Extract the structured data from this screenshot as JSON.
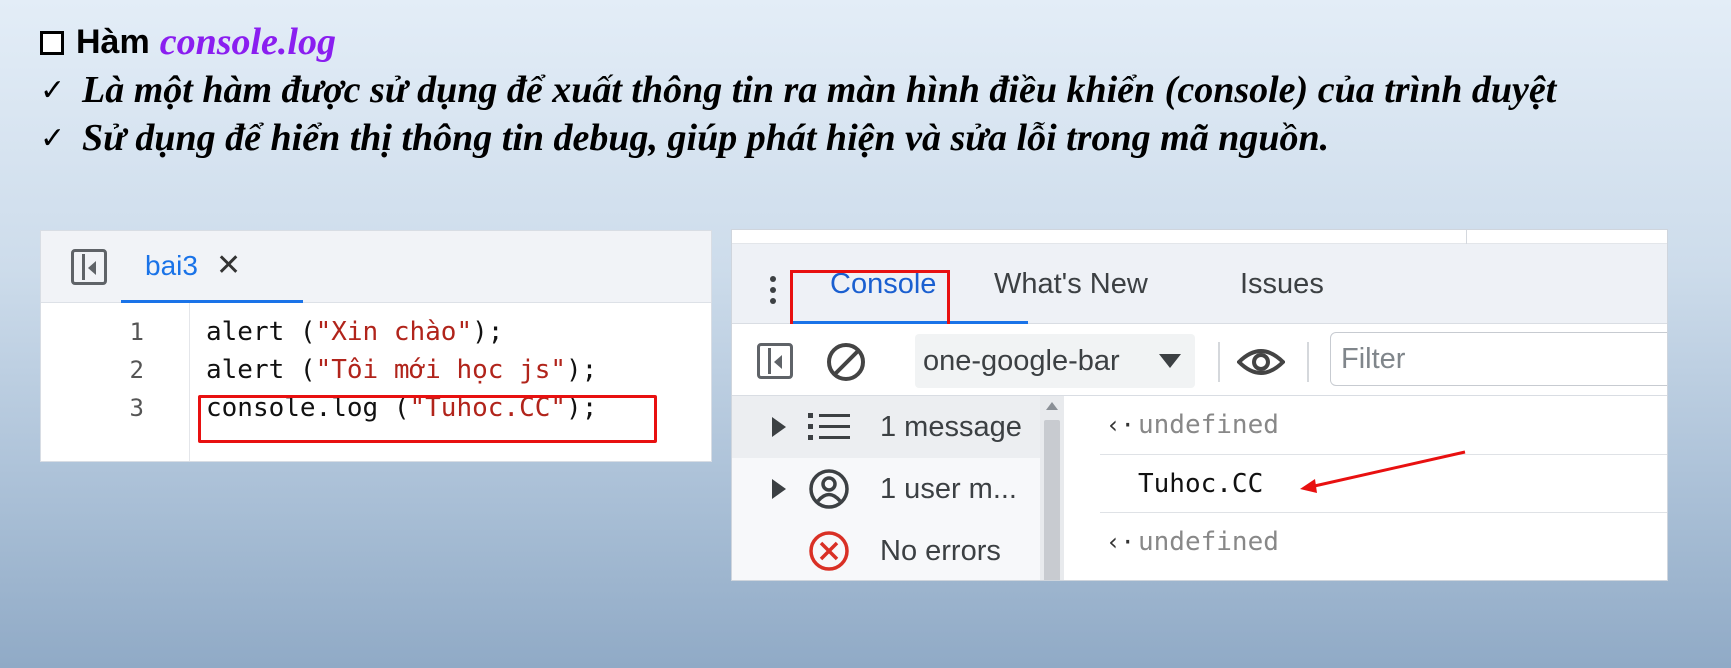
{
  "slide": {
    "heading_word": "Hàm",
    "heading_code": "console.log",
    "points": [
      "Là một hàm được sử dụng để xuất thông tin ra màn hình điều khiển (console) của trình duyệt",
      "Sử dụng để hiển thị thông tin debug, giúp phát hiện và sửa lỗi trong mã nguồn."
    ],
    "check_glyph": "✓"
  },
  "editor": {
    "tab_name": "bai3",
    "tab_close": "✕",
    "lines": [
      {
        "no": "1",
        "fn": "alert (",
        "str": "\"Xin chào\"",
        "end": ");"
      },
      {
        "no": "2",
        "fn": "alert (",
        "str": "\"Tôi mới học js\"",
        "end": ");"
      },
      {
        "no": "3",
        "fn": "console.log (",
        "str": "\"Tuhoc.CC\"",
        "end": ");"
      }
    ]
  },
  "devtools": {
    "tabs": [
      "Console",
      "What's New",
      "Issues"
    ],
    "context": "one-google-bar",
    "filter_placeholder": "Filter",
    "sidebar": [
      {
        "label": "1 message",
        "icon": "list-icon"
      },
      {
        "label": "1 user m...",
        "icon": "user-icon"
      },
      {
        "label": "No errors",
        "icon": "error-icon"
      }
    ],
    "log": {
      "return_glyph": "‹·",
      "row1": "undefined",
      "row2": "Tuhoc.CC",
      "row3": "undefined"
    },
    "colors": {
      "accent": "#1a73e8",
      "highlight": "#e81010",
      "error": "#d93025"
    }
  }
}
